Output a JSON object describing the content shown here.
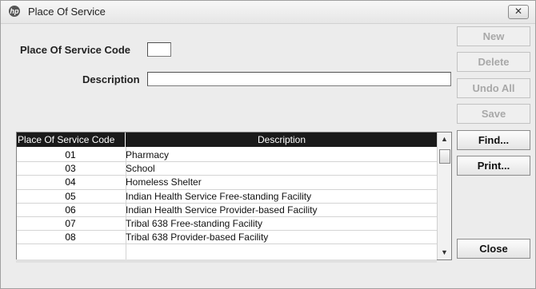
{
  "window": {
    "title": "Place Of Service",
    "close_glyph": "✕",
    "app_icon": "hp-logo-icon"
  },
  "form": {
    "code_label": "Place Of Service Code",
    "code_value": "",
    "description_label": "Description",
    "description_value": ""
  },
  "buttons": {
    "new": "New",
    "delete": "Delete",
    "undo_all": "Undo All",
    "save": "Save",
    "find": "Find...",
    "print": "Print...",
    "close": "Close"
  },
  "grid": {
    "headers": [
      "Place Of Service Code",
      "Description"
    ],
    "rows": [
      {
        "code": "01",
        "description": "Pharmacy"
      },
      {
        "code": "03",
        "description": "School"
      },
      {
        "code": "04",
        "description": "Homeless Shelter"
      },
      {
        "code": "05",
        "description": "Indian Health Service Free-standing Facility"
      },
      {
        "code": "06",
        "description": "Indian Health Service Provider-based Facility"
      },
      {
        "code": "07",
        "description": "Tribal 638 Free-standing Facility"
      },
      {
        "code": "08",
        "description": "Tribal 638 Provider-based Facility"
      }
    ]
  },
  "colors": {
    "header_bg": "#1a1a1a",
    "window_bg": "#ececec",
    "disabled_text": "#a8a8a8"
  }
}
